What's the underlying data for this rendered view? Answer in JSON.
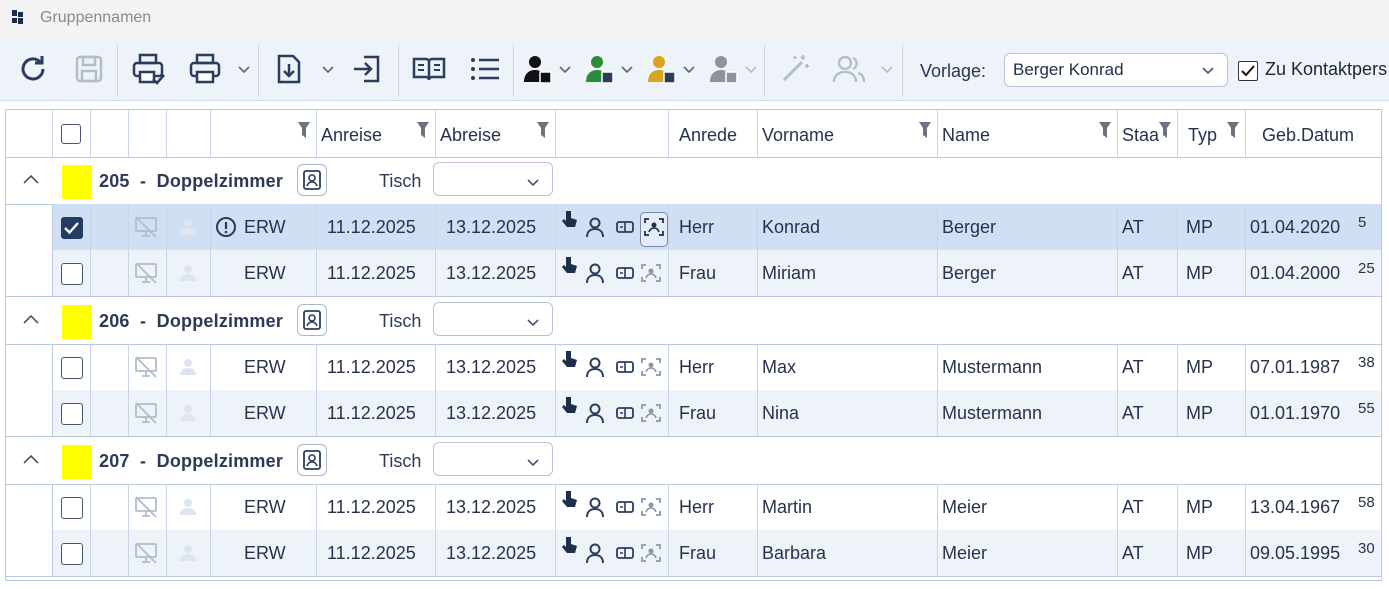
{
  "window": {
    "title": "Gruppennamen"
  },
  "toolbar": {
    "buttons": [
      {
        "name": "refresh-icon"
      },
      {
        "name": "save-icon"
      },
      {
        "name": "print-check-icon"
      },
      {
        "name": "print-icon"
      },
      {
        "name": "import-icon"
      },
      {
        "name": "login-arrow-icon"
      },
      {
        "name": "book-icon"
      },
      {
        "name": "list-icon"
      },
      {
        "name": "person-black-icon"
      },
      {
        "name": "person-green-icon"
      },
      {
        "name": "person-yellow-icon"
      },
      {
        "name": "person-gray-icon"
      },
      {
        "name": "magic-wand-icon"
      },
      {
        "name": "group-icon"
      }
    ],
    "vorlage_label": "Vorlage:",
    "vorlage_value": "Berger Konrad",
    "kontakt_label": "Zu Kontaktpers",
    "kontakt_checked": true,
    "colors": {
      "black": "#111111",
      "green": "#2e8b3a",
      "yellow": "#d9a520",
      "gray": "#8d939c"
    }
  },
  "grid": {
    "headers": [
      "Anreise",
      "Abreise",
      "Anrede",
      "Vorname",
      "Name",
      "Staa",
      "Typ",
      "Geb.Datum"
    ],
    "groups": [
      {
        "title": "205  -  Doppelzimmer",
        "tisch_label": "Tisch",
        "color": "#ffff00",
        "rows": [
          {
            "checked": true,
            "erw": "ERW",
            "warn": true,
            "anreise": "11.12.2025",
            "abreise": "13.12.2025",
            "anrede": "Herr",
            "vorname": "Konrad",
            "name": "Berger",
            "staat": "AT",
            "typ": "MP",
            "geb": "01.04.2020",
            "extra": "5"
          },
          {
            "checked": false,
            "erw": "ERW",
            "warn": false,
            "anreise": "11.12.2025",
            "abreise": "13.12.2025",
            "anrede": "Frau",
            "vorname": "Miriam",
            "name": "Berger",
            "staat": "AT",
            "typ": "MP",
            "geb": "01.04.2000",
            "extra": "25"
          }
        ]
      },
      {
        "title": "206  -  Doppelzimmer",
        "tisch_label": "Tisch",
        "color": "#ffff00",
        "rows": [
          {
            "checked": false,
            "erw": "ERW",
            "warn": false,
            "anreise": "11.12.2025",
            "abreise": "13.12.2025",
            "anrede": "Herr",
            "vorname": "Max",
            "name": "Mustermann",
            "staat": "AT",
            "typ": "MP",
            "geb": "07.01.1987",
            "extra": "38"
          },
          {
            "checked": false,
            "erw": "ERW",
            "warn": false,
            "anreise": "11.12.2025",
            "abreise": "13.12.2025",
            "anrede": "Frau",
            "vorname": "Nina",
            "name": "Mustermann",
            "staat": "AT",
            "typ": "MP",
            "geb": "01.01.1970",
            "extra": "55"
          }
        ]
      },
      {
        "title": "207  -  Doppelzimmer",
        "tisch_label": "Tisch",
        "color": "#ffff00",
        "rows": [
          {
            "checked": false,
            "erw": "ERW",
            "warn": false,
            "anreise": "11.12.2025",
            "abreise": "13.12.2025",
            "anrede": "Herr",
            "vorname": "Martin",
            "name": "Meier",
            "staat": "AT",
            "typ": "MP",
            "geb": "13.04.1967",
            "extra": "58"
          },
          {
            "checked": false,
            "erw": "ERW",
            "warn": false,
            "anreise": "11.12.2025",
            "abreise": "13.12.2025",
            "anrede": "Frau",
            "vorname": "Barbara",
            "name": "Meier",
            "staat": "AT",
            "typ": "MP",
            "geb": "09.05.1995",
            "extra": "30"
          }
        ]
      }
    ]
  }
}
